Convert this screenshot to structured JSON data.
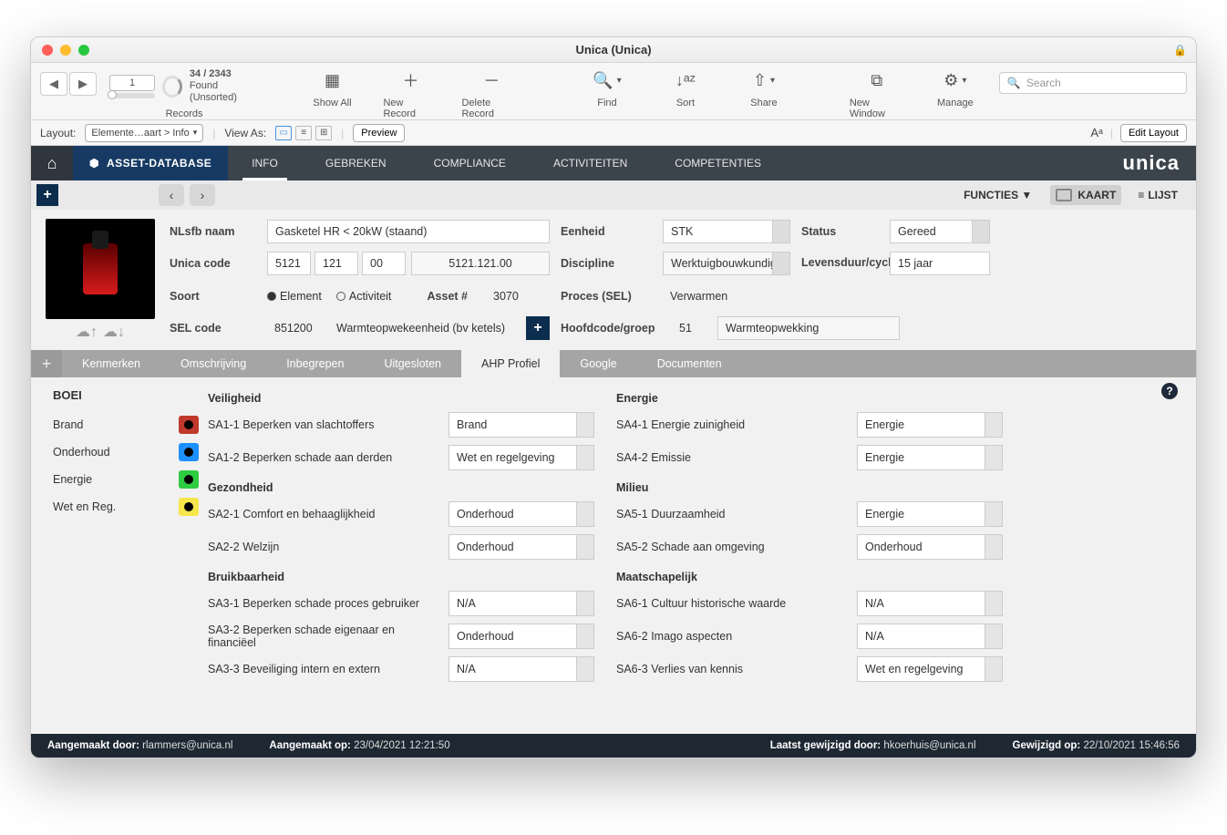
{
  "window": {
    "title": "Unica (Unica)"
  },
  "toolbar": {
    "record_current": "1",
    "record_count": "34 / 2343",
    "record_status": "Found (Unsorted)",
    "records_label": "Records",
    "show_all": "Show All",
    "new_record": "New Record",
    "delete_record": "Delete Record",
    "find": "Find",
    "sort": "Sort",
    "share": "Share",
    "new_window": "New Window",
    "manage": "Manage",
    "search_placeholder": "Search"
  },
  "layout_strip": {
    "layout_label": "Layout:",
    "layout_value": "Elemente…aart > Info",
    "view_as": "View As:",
    "preview": "Preview",
    "edit_layout": "Edit Layout"
  },
  "navbar": {
    "db_label": "ASSET-DATABASE",
    "tabs": [
      "INFO",
      "GEBREKEN",
      "COMPLIANCE",
      "ACTIVITEITEN",
      "COMPETENTIES"
    ],
    "active_tab": 0,
    "logo": "unica"
  },
  "substrip": {
    "functies": "FUNCTIES ▼",
    "kaart": "KAART",
    "lijst": "LIJST"
  },
  "header": {
    "nlsfb_label": "NLsfb naam",
    "nlsfb_value": "Gasketel HR < 20kW (staand)",
    "eenheid_label": "Eenheid",
    "eenheid_value": "STK",
    "status_label": "Status",
    "status_value": "Gereed",
    "unica_label": "Unica code",
    "unica_c1": "5121",
    "unica_c2": "121",
    "unica_c3": "00",
    "unica_full": "5121.121.00",
    "discipline_label": "Discipline",
    "discipline_value": "Werktuigbouwkundig",
    "levensduur_label": "Levensduur/cyclus",
    "levensduur_value": "15 jaar",
    "soort_label": "Soort",
    "soort_opt1": "Element",
    "soort_opt2": "Activiteit",
    "asset_label": "Asset #",
    "asset_value": "3070",
    "proces_label": "Proces (SEL)",
    "proces_value": "Verwarmen",
    "sel_label": "SEL code",
    "sel_value": "851200",
    "sel_desc": "Warmteopwekeenheid (bv ketels)",
    "hoofd_label": "Hoofdcode/groep",
    "hoofd_code": "51",
    "hoofd_desc": "Warmteopwekking"
  },
  "tabs2": {
    "items": [
      "Kenmerken",
      "Omschrijving",
      "Inbegrepen",
      "Uitgesloten",
      "AHP Profiel",
      "Google",
      "Documenten"
    ],
    "active": 4
  },
  "boei": {
    "title": "BOEI",
    "rows": [
      {
        "label": "Brand",
        "color": "sw-red"
      },
      {
        "label": "Onderhoud",
        "color": "sw-blue"
      },
      {
        "label": "Energie",
        "color": "sw-green"
      },
      {
        "label": "Wet en Reg.",
        "color": "sw-yellow"
      }
    ]
  },
  "ahp": {
    "left": [
      {
        "section": "Veiligheid"
      },
      {
        "label": "SA1-1 Beperken van slachtoffers",
        "value": "Brand"
      },
      {
        "label": "SA1-2 Beperken schade aan derden",
        "value": "Wet en regelgeving"
      },
      {
        "section": "Gezondheid"
      },
      {
        "label": "SA2-1 Comfort en behaaglijkheid",
        "value": "Onderhoud"
      },
      {
        "label": "SA2-2 Welzijn",
        "value": "Onderhoud"
      },
      {
        "section": "Bruikbaarheid"
      },
      {
        "label": "SA3-1 Beperken schade proces gebruiker",
        "value": "N/A"
      },
      {
        "label": "SA3-2 Beperken schade eigenaar en financiëel",
        "value": "Onderhoud"
      },
      {
        "label": "SA3-3 Beveiliging intern en extern",
        "value": "N/A"
      }
    ],
    "right": [
      {
        "section": "Energie"
      },
      {
        "label": "SA4-1 Energie zuinigheid",
        "value": "Energie"
      },
      {
        "label": "SA4-2 Emissie",
        "value": "Energie"
      },
      {
        "section": "Milieu"
      },
      {
        "label": "SA5-1 Duurzaamheid",
        "value": "Energie"
      },
      {
        "label": "SA5-2 Schade aan omgeving",
        "value": "Onderhoud"
      },
      {
        "section": "Maatschapelijk"
      },
      {
        "label": "SA6-1 Cultuur historische waarde",
        "value": "N/A"
      },
      {
        "label": "SA6-2 Imago aspecten",
        "value": "N/A"
      },
      {
        "label": "SA6-3 Verlies van kennis",
        "value": "Wet en regelgeving"
      }
    ]
  },
  "footer": {
    "created_by_label": "Aangemaakt door:",
    "created_by": "rlammers@unica.nl",
    "created_on_label": "Aangemaakt op:",
    "created_on": "23/04/2021 12:21:50",
    "modified_by_label": "Laatst gewijzigd door:",
    "modified_by": "hkoerhuis@unica.nl",
    "modified_on_label": "Gewijzigd op:",
    "modified_on": "22/10/2021 15:46:56"
  }
}
